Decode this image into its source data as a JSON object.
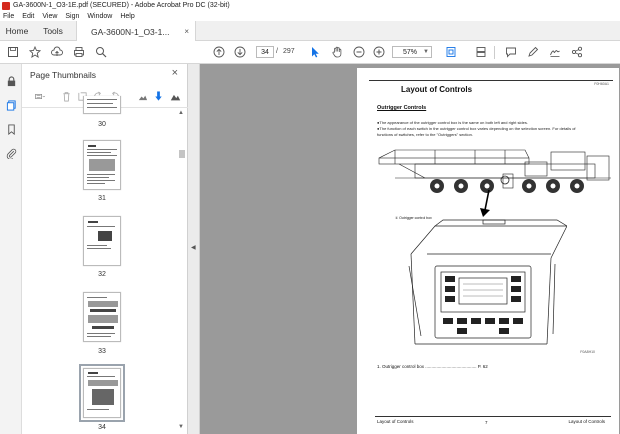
{
  "window": {
    "title": "GA-3600N-1_O3-1E.pdf (SECURED) - Adobe Acrobat Pro DC (32-bit)"
  },
  "menu": [
    "File",
    "Edit",
    "View",
    "Sign",
    "Window",
    "Help"
  ],
  "tabs": {
    "home": "Home",
    "tools": "Tools",
    "document": "GA-3600N-1_O3-1...",
    "close_glyph": "×"
  },
  "toolbar": {
    "current_page": "34",
    "page_separator": "/",
    "total_pages": "297",
    "zoom": "57%"
  },
  "thumbnails_panel": {
    "title": "Page Thumbnails",
    "close_glyph": "×",
    "pages": [
      {
        "number": "30",
        "selected": false
      },
      {
        "number": "31",
        "selected": false
      },
      {
        "number": "32",
        "selected": false
      },
      {
        "number": "33",
        "selected": false
      },
      {
        "number": "34",
        "selected": true
      }
    ]
  },
  "document_page": {
    "title": "Layout of Controls",
    "code_top": "F0H60A1",
    "section": "Outrigger Controls",
    "bullets": [
      "●The appearance of the outrigger control box is the same on both left and right sides.",
      "●The function of each switch in the outrigger control box varies depending on the selection screen. For details of",
      "functions of switches, refer to the \"Outriggers\" section."
    ],
    "callout_label": "① Outrigger control box",
    "figure_code": "F0A8H10",
    "caption": "1. Outrigger control box ......................................... P. 62",
    "footer_left": "Layout of Controls",
    "footer_center": "7",
    "footer_right": "Layout of Controls"
  },
  "colors": {
    "app_icon": "#d42a1e",
    "accent_blue": "#1473e6",
    "viewer_bg": "#9a9a9a"
  }
}
